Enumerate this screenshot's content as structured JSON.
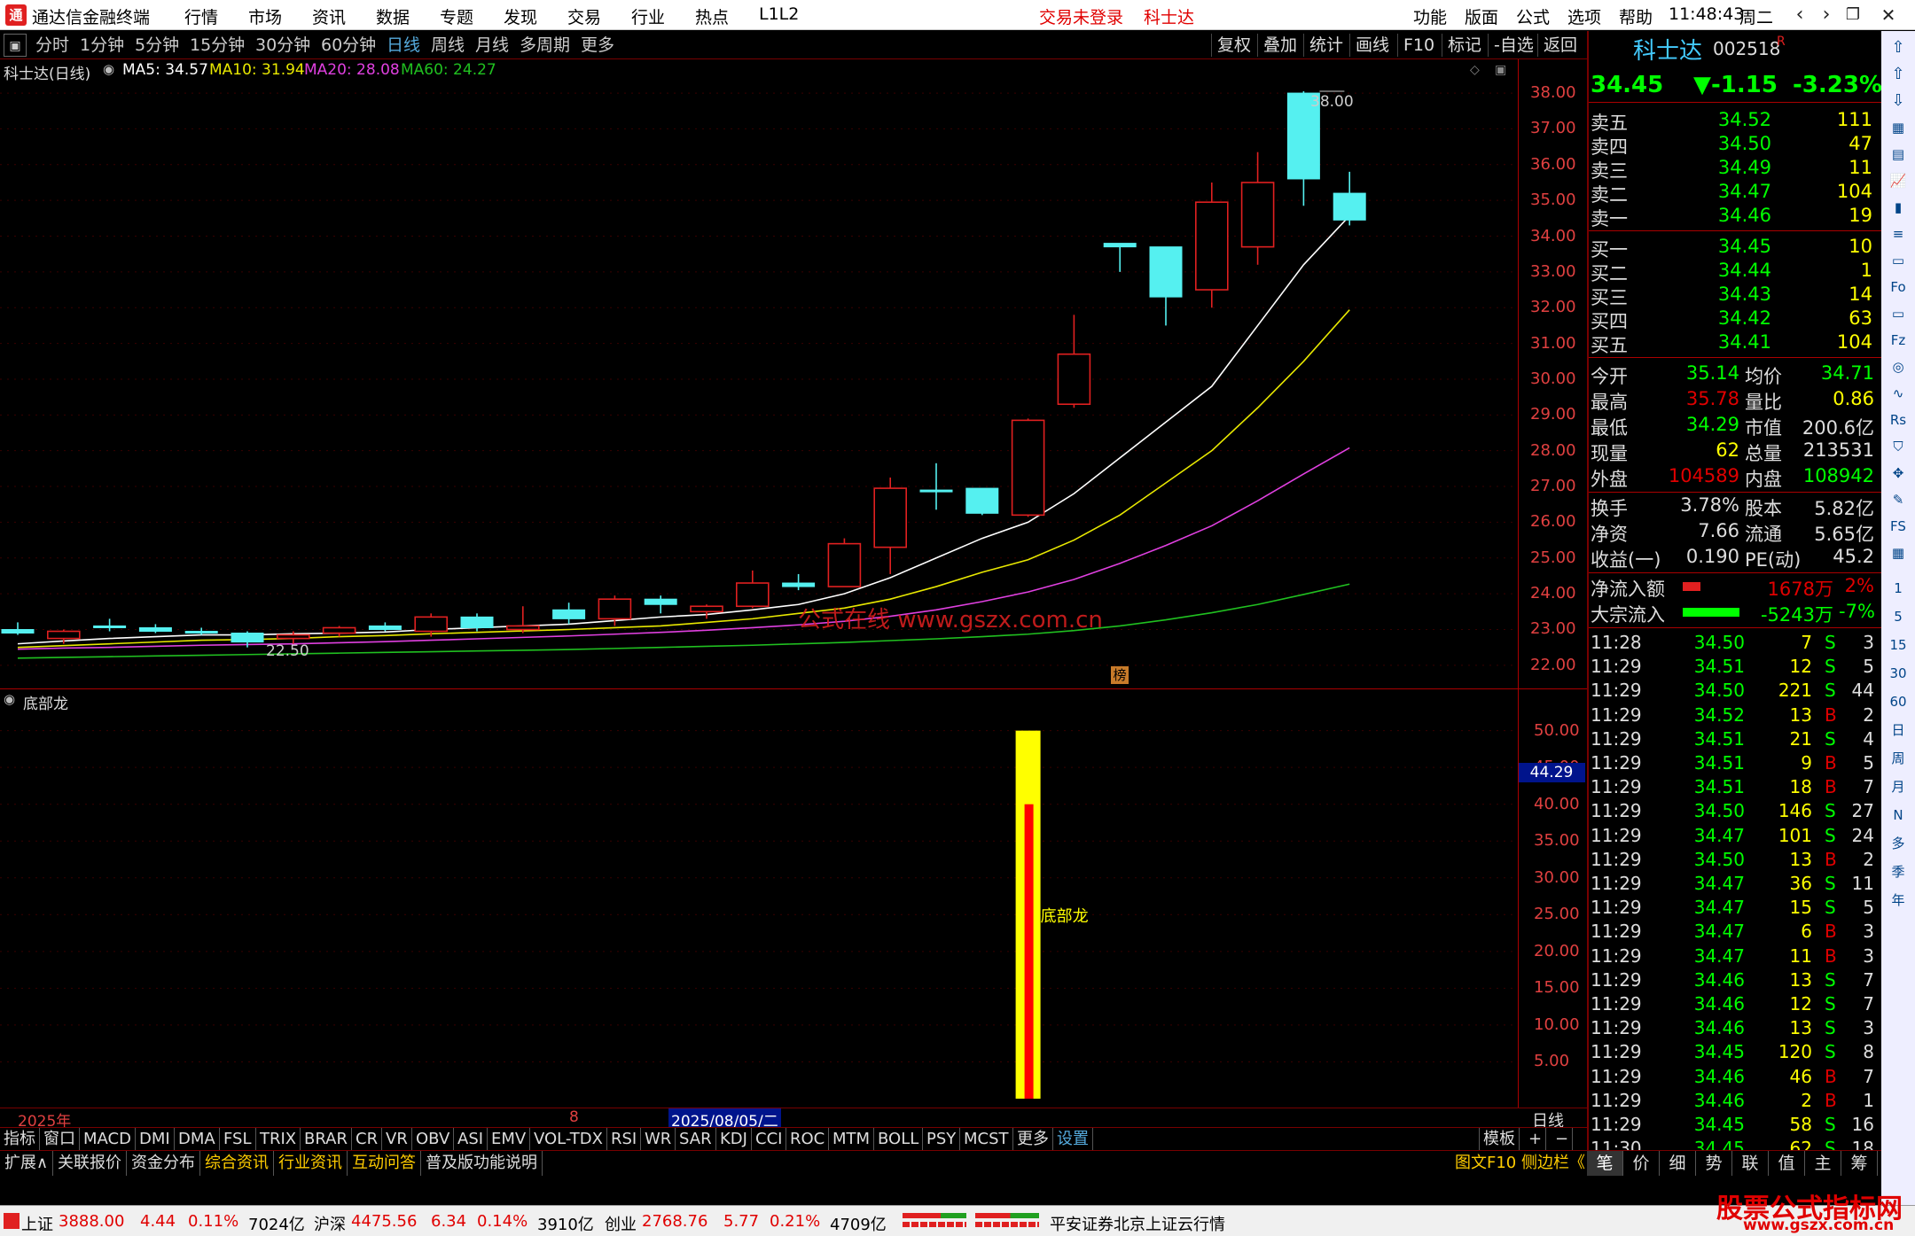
{
  "titlebar": {
    "app_title": "通达信金融终端",
    "menu": [
      "行情",
      "市场",
      "资讯",
      "数据",
      "专题",
      "发现",
      "交易",
      "行业",
      "热点",
      "L1L2"
    ],
    "trade_status": "交易未登录",
    "stock_name": "科士达",
    "right_menu": [
      "功能",
      "版面",
      "公式",
      "选项",
      "帮助"
    ],
    "clock": "11:48:43",
    "weekday": "周二"
  },
  "periodbar": {
    "periods": [
      "分时",
      "1分钟",
      "5分钟",
      "15分钟",
      "30分钟",
      "60分钟",
      "日线",
      "周线",
      "月线",
      "多周期",
      "更多"
    ],
    "active": "日线",
    "tools": [
      "复权",
      "叠加",
      "统计",
      "画线",
      "F10",
      "标记",
      "-自选",
      "返回"
    ]
  },
  "chart_legend": {
    "title": "科士达(日线)",
    "ma5": "MA5: 34.57",
    "ma10": "MA10: 31.94",
    "ma20": "MA20: 28.08",
    "ma60": "MA60: 24.27"
  },
  "colors": {
    "ma5": "#ffffff",
    "ma10": "#e8e800",
    "ma20": "#e040e0",
    "ma60": "#20c020",
    "up": "#e02020",
    "down": "#55f0f0",
    "axis": "#e04040"
  },
  "price_axis": [
    "38.00",
    "37.00",
    "36.00",
    "35.00",
    "34.00",
    "33.00",
    "32.00",
    "31.00",
    "30.00",
    "29.00",
    "28.00",
    "27.00",
    "26.00",
    "25.00",
    "24.00",
    "23.00",
    "22.00"
  ],
  "price_annotations": {
    "high": "38.00",
    "low": "22.50",
    "watermark": "公式在线  www.gszx.com.cn",
    "badge": "榜"
  },
  "chart_data": {
    "type": "candlestick",
    "ylim": [
      21.6,
      38.2
    ],
    "candles": [
      {
        "o": 23.0,
        "h": 23.2,
        "l": 22.85,
        "c": 22.9
      },
      {
        "o": 22.75,
        "h": 23.0,
        "l": 22.6,
        "c": 22.95
      },
      {
        "o": 23.1,
        "h": 23.3,
        "l": 22.95,
        "c": 23.05
      },
      {
        "o": 23.05,
        "h": 23.15,
        "l": 22.9,
        "c": 22.95
      },
      {
        "o": 22.95,
        "h": 23.05,
        "l": 22.85,
        "c": 22.9
      },
      {
        "o": 22.9,
        "h": 22.95,
        "l": 22.5,
        "c": 22.65
      },
      {
        "o": 22.75,
        "h": 22.95,
        "l": 22.6,
        "c": 22.85
      },
      {
        "o": 22.9,
        "h": 23.1,
        "l": 22.8,
        "c": 23.05
      },
      {
        "o": 23.1,
        "h": 23.2,
        "l": 22.95,
        "c": 23.0
      },
      {
        "o": 22.95,
        "h": 23.45,
        "l": 22.8,
        "c": 23.35
      },
      {
        "o": 23.35,
        "h": 23.45,
        "l": 22.95,
        "c": 23.05
      },
      {
        "o": 23.0,
        "h": 23.65,
        "l": 22.9,
        "c": 23.1
      },
      {
        "o": 23.55,
        "h": 23.75,
        "l": 23.15,
        "c": 23.3
      },
      {
        "o": 23.3,
        "h": 23.95,
        "l": 23.1,
        "c": 23.85
      },
      {
        "o": 23.85,
        "h": 23.95,
        "l": 23.45,
        "c": 23.7
      },
      {
        "o": 23.5,
        "h": 23.7,
        "l": 23.3,
        "c": 23.65
      },
      {
        "o": 23.65,
        "h": 24.65,
        "l": 23.6,
        "c": 24.3
      },
      {
        "o": 24.3,
        "h": 24.55,
        "l": 24.1,
        "c": 24.2
      },
      {
        "o": 24.2,
        "h": 25.55,
        "l": 24.2,
        "c": 25.4
      },
      {
        "o": 25.3,
        "h": 27.25,
        "l": 24.55,
        "c": 26.95
      },
      {
        "o": 26.9,
        "h": 27.65,
        "l": 26.35,
        "c": 26.85
      },
      {
        "o": 26.95,
        "h": 26.95,
        "l": 26.2,
        "c": 26.25
      },
      {
        "o": 26.2,
        "h": 28.9,
        "l": 26.15,
        "c": 28.85
      },
      {
        "o": 29.3,
        "h": 31.8,
        "l": 29.2,
        "c": 30.7
      },
      {
        "o": 33.8,
        "h": 33.8,
        "l": 33.0,
        "c": 33.7
      },
      {
        "o": 33.7,
        "h": 33.7,
        "l": 31.5,
        "c": 32.3
      },
      {
        "o": 32.5,
        "h": 35.5,
        "l": 32.0,
        "c": 34.95
      },
      {
        "o": 33.7,
        "h": 36.35,
        "l": 33.2,
        "c": 35.5
      },
      {
        "o": 38.0,
        "h": 38.05,
        "l": 34.85,
        "c": 35.6
      },
      {
        "o": 35.2,
        "h": 35.8,
        "l": 34.3,
        "c": 34.45
      }
    ],
    "ma5": [
      22.6,
      22.68,
      22.75,
      22.8,
      22.85,
      22.85,
      22.88,
      22.9,
      22.93,
      23.0,
      23.05,
      23.1,
      23.15,
      23.25,
      23.35,
      23.42,
      23.55,
      23.7,
      24.0,
      24.45,
      25.0,
      25.55,
      26.0,
      26.8,
      27.8,
      28.8,
      29.8,
      31.5,
      33.2,
      34.57
    ],
    "ma10": [
      22.5,
      22.55,
      22.6,
      22.65,
      22.7,
      22.72,
      22.75,
      22.8,
      22.83,
      22.88,
      22.92,
      22.96,
      23.0,
      23.05,
      23.1,
      23.2,
      23.3,
      23.45,
      23.6,
      23.85,
      24.2,
      24.6,
      24.95,
      25.5,
      26.2,
      27.1,
      28.0,
      29.2,
      30.5,
      31.94
    ],
    "ma20": [
      22.45,
      22.48,
      22.5,
      22.53,
      22.56,
      22.58,
      22.6,
      22.63,
      22.66,
      22.7,
      22.74,
      22.78,
      22.82,
      22.87,
      22.92,
      22.98,
      23.05,
      23.13,
      23.23,
      23.37,
      23.55,
      23.78,
      24.05,
      24.4,
      24.85,
      25.35,
      25.9,
      26.6,
      27.35,
      28.08
    ],
    "ma60": [
      22.2,
      22.22,
      22.24,
      22.26,
      22.28,
      22.3,
      22.32,
      22.34,
      22.36,
      22.38,
      22.4,
      22.42,
      22.44,
      22.47,
      22.5,
      22.53,
      22.56,
      22.6,
      22.64,
      22.69,
      22.74,
      22.8,
      22.87,
      22.97,
      23.1,
      23.27,
      23.47,
      23.7,
      23.98,
      24.27
    ]
  },
  "indicator": {
    "name": "底部龙",
    "label": "底部龙",
    "axis": [
      "50.00",
      "45.00",
      "40.00",
      "35.00",
      "30.00",
      "25.00",
      "20.00",
      "15.00",
      "10.00",
      "5.00"
    ],
    "current": "44.29",
    "ylim": [
      0,
      52
    ],
    "bar_index": 22,
    "yellow_value": 50,
    "red_value": 40
  },
  "datebar": {
    "year": "2025年",
    "mid": "8",
    "cursor": "2025/08/05/二",
    "period": "日线"
  },
  "indicator_tabs": [
    "指标",
    "窗口",
    "MACD",
    "DMI",
    "DMA",
    "FSL",
    "TRIX",
    "BRAR",
    "CR",
    "VR",
    "OBV",
    "ASI",
    "EMV",
    "VOL-TDX",
    "RSI",
    "WR",
    "SAR",
    "KDJ",
    "CCI",
    "ROC",
    "MTM",
    "BOLL",
    "PSY",
    "MCST",
    "更多",
    "设置"
  ],
  "template_label": "模板",
  "ext_tabs": [
    "扩展∧",
    "关联报价",
    "资金分布",
    "综合资讯",
    "行业资讯",
    "互动问答",
    "普及版功能说明"
  ],
  "ext_right": "图文F10  侧边栏《",
  "quote": {
    "name": "科士达",
    "code": "002518",
    "r": "R",
    "price": "34.45",
    "change": "▼-1.15",
    "pct": "-3.23%",
    "asks": [
      {
        "label": "卖五",
        "price": "34.52",
        "vol": "111"
      },
      {
        "label": "卖四",
        "price": "34.50",
        "vol": "47"
      },
      {
        "label": "卖三",
        "price": "34.49",
        "vol": "11"
      },
      {
        "label": "卖二",
        "price": "34.47",
        "vol": "104"
      },
      {
        "label": "卖一",
        "price": "34.46",
        "vol": "19"
      }
    ],
    "bids": [
      {
        "label": "买一",
        "price": "34.45",
        "vol": "10"
      },
      {
        "label": "买二",
        "price": "34.44",
        "vol": "1"
      },
      {
        "label": "买三",
        "price": "34.43",
        "vol": "14"
      },
      {
        "label": "买四",
        "price": "34.42",
        "vol": "63"
      },
      {
        "label": "买五",
        "price": "34.41",
        "vol": "104"
      }
    ],
    "stats1": [
      {
        "l1": "今开",
        "v1": "35.14",
        "l2": "均价",
        "v2": "34.71"
      },
      {
        "l1": "最高",
        "v1": "35.78",
        "l2": "量比",
        "v2": "0.86"
      },
      {
        "l1": "最低",
        "v1": "34.29",
        "l2": "市值",
        "v2": "200.6亿"
      },
      {
        "l1": "现量",
        "v1": "62",
        "l2": "总量",
        "v2": "213531"
      },
      {
        "l1": "外盘",
        "v1": "104589",
        "l2": "内盘",
        "v2": "108942"
      }
    ],
    "stats2": [
      {
        "l1": "换手",
        "v1": "3.78%",
        "l2": "股本",
        "v2": "5.82亿"
      },
      {
        "l1": "净资",
        "v1": "7.66",
        "l2": "流通",
        "v2": "5.65亿"
      },
      {
        "l1": "收益(一)",
        "v1": "0.190",
        "l2": "PE(动)",
        "v2": "45.2"
      }
    ],
    "flows": [
      {
        "label": "净流入额",
        "value": "1678万",
        "pct": "2%"
      },
      {
        "label": "大宗流入",
        "value": "-5243万",
        "pct": "-7%"
      }
    ],
    "ticks": [
      {
        "t": "11:28",
        "p": "34.50",
        "v": "7",
        "d": "S",
        "n": "3"
      },
      {
        "t": "11:29",
        "p": "34.51",
        "v": "12",
        "d": "S",
        "n": "5"
      },
      {
        "t": "11:29",
        "p": "34.50",
        "v": "221",
        "d": "S",
        "n": "44"
      },
      {
        "t": "11:29",
        "p": "34.52",
        "v": "13",
        "d": "B",
        "n": "2"
      },
      {
        "t": "11:29",
        "p": "34.51",
        "v": "21",
        "d": "S",
        "n": "4"
      },
      {
        "t": "11:29",
        "p": "34.51",
        "v": "9",
        "d": "B",
        "n": "5"
      },
      {
        "t": "11:29",
        "p": "34.51",
        "v": "18",
        "d": "B",
        "n": "7"
      },
      {
        "t": "11:29",
        "p": "34.50",
        "v": "146",
        "d": "S",
        "n": "27"
      },
      {
        "t": "11:29",
        "p": "34.47",
        "v": "101",
        "d": "S",
        "n": "24"
      },
      {
        "t": "11:29",
        "p": "34.50",
        "v": "13",
        "d": "B",
        "n": "2"
      },
      {
        "t": "11:29",
        "p": "34.47",
        "v": "36",
        "d": "S",
        "n": "11"
      },
      {
        "t": "11:29",
        "p": "34.47",
        "v": "15",
        "d": "S",
        "n": "5"
      },
      {
        "t": "11:29",
        "p": "34.47",
        "v": "6",
        "d": "B",
        "n": "3"
      },
      {
        "t": "11:29",
        "p": "34.47",
        "v": "11",
        "d": "B",
        "n": "3"
      },
      {
        "t": "11:29",
        "p": "34.46",
        "v": "13",
        "d": "S",
        "n": "7"
      },
      {
        "t": "11:29",
        "p": "34.46",
        "v": "12",
        "d": "S",
        "n": "7"
      },
      {
        "t": "11:29",
        "p": "34.46",
        "v": "13",
        "d": "S",
        "n": "3"
      },
      {
        "t": "11:29",
        "p": "34.45",
        "v": "120",
        "d": "S",
        "n": "8"
      },
      {
        "t": "11:29",
        "p": "34.46",
        "v": "46",
        "d": "B",
        "n": "7"
      },
      {
        "t": "11:29",
        "p": "34.46",
        "v": "2",
        "d": "B",
        "n": "1"
      },
      {
        "t": "11:29",
        "p": "34.45",
        "v": "58",
        "d": "S",
        "n": "16"
      },
      {
        "t": "11:30",
        "p": "34.45",
        "v": "62",
        "d": "S",
        "n": "18"
      }
    ]
  },
  "right_tabs": [
    "笔",
    "价",
    "细",
    "势",
    "联",
    "值",
    "主",
    "筹"
  ],
  "statusbar": {
    "sh_name": "上证",
    "sh_val": "3888.00",
    "sh_chg": "4.44",
    "sh_pct": "0.11%",
    "sh_amt": "7024亿",
    "hs_name": "沪深",
    "hs_val": "4475.56",
    "hs_chg": "6.34",
    "hs_pct": "0.14%",
    "hs_amt": "3910亿",
    "cy_name": "创业",
    "cy_val": "2768.76",
    "cy_chg": "5.77",
    "cy_pct": "0.21%",
    "cy_amt": "4709亿",
    "broker": "平安证券北京上证云行情",
    "brand": "股票公式指标网",
    "brand_url": "www.gszx.com.cn"
  },
  "side_icons": [
    "up-arrow-icon",
    "up-icon",
    "down-icon",
    "grid-icon",
    "list-icon",
    "chart-icon",
    "candle-icon",
    "f10-icon",
    "doc-icon",
    "fio-icon",
    "doc2-icon",
    "fiz-icon",
    "circle-icon",
    "wave-icon",
    "rsi-icon",
    "shield-icon",
    "move-icon",
    "pen-icon",
    "fs-icon",
    "grid2-icon"
  ],
  "side_periods": [
    "1",
    "5",
    "15",
    "30",
    "60",
    "日",
    "周",
    "月",
    "N",
    "多",
    "季",
    "年"
  ]
}
